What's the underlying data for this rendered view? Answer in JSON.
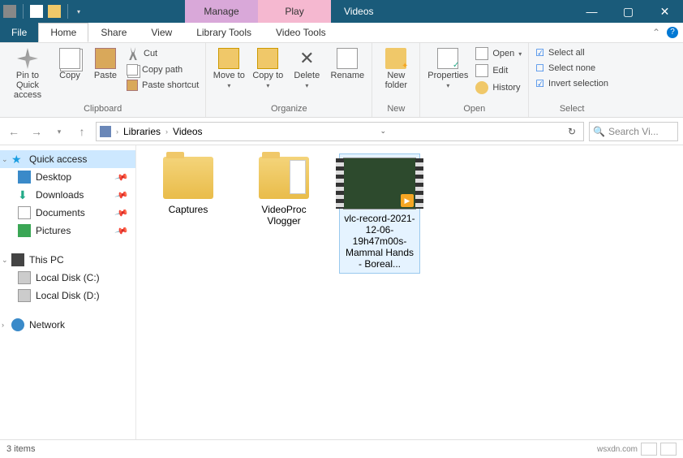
{
  "titlebar": {
    "context_tabs": {
      "manage": "Manage",
      "play": "Play"
    },
    "title": "Videos"
  },
  "menubar": {
    "file": "File",
    "tabs": [
      "Home",
      "Share",
      "View",
      "Library Tools",
      "Video Tools"
    ]
  },
  "ribbon": {
    "pin": "Pin to Quick access",
    "copy": "Copy",
    "paste": "Paste",
    "cut": "Cut",
    "copypath": "Copy path",
    "pasteshort": "Paste shortcut",
    "clipboard": "Clipboard",
    "moveto": "Move to",
    "copyto": "Copy to",
    "delete": "Delete",
    "rename": "Rename",
    "organize": "Organize",
    "newfolder": "New folder",
    "new": "New",
    "properties": "Properties",
    "open_lbl": "Open",
    "edit": "Edit",
    "history": "History",
    "open_group": "Open",
    "selectall": "Select all",
    "selectnone": "Select none",
    "invertsel": "Invert selection",
    "select": "Select"
  },
  "address": {
    "root": "Libraries",
    "current": "Videos",
    "search_placeholder": "Search Vi..."
  },
  "sidebar": {
    "quick": "Quick access",
    "items": [
      "Desktop",
      "Downloads",
      "Documents",
      "Pictures"
    ],
    "thispc": "This PC",
    "drives": [
      "Local Disk (C:)",
      "Local Disk (D:)"
    ],
    "network": "Network"
  },
  "files": {
    "captures": "Captures",
    "videoproc": "VideoProc Vlogger",
    "video": "vlc-record-2021-12-06-19h47m00s-Mammal Hands - Boreal..."
  },
  "status": {
    "count": "3 items",
    "watermark": "wsxdn.com"
  }
}
